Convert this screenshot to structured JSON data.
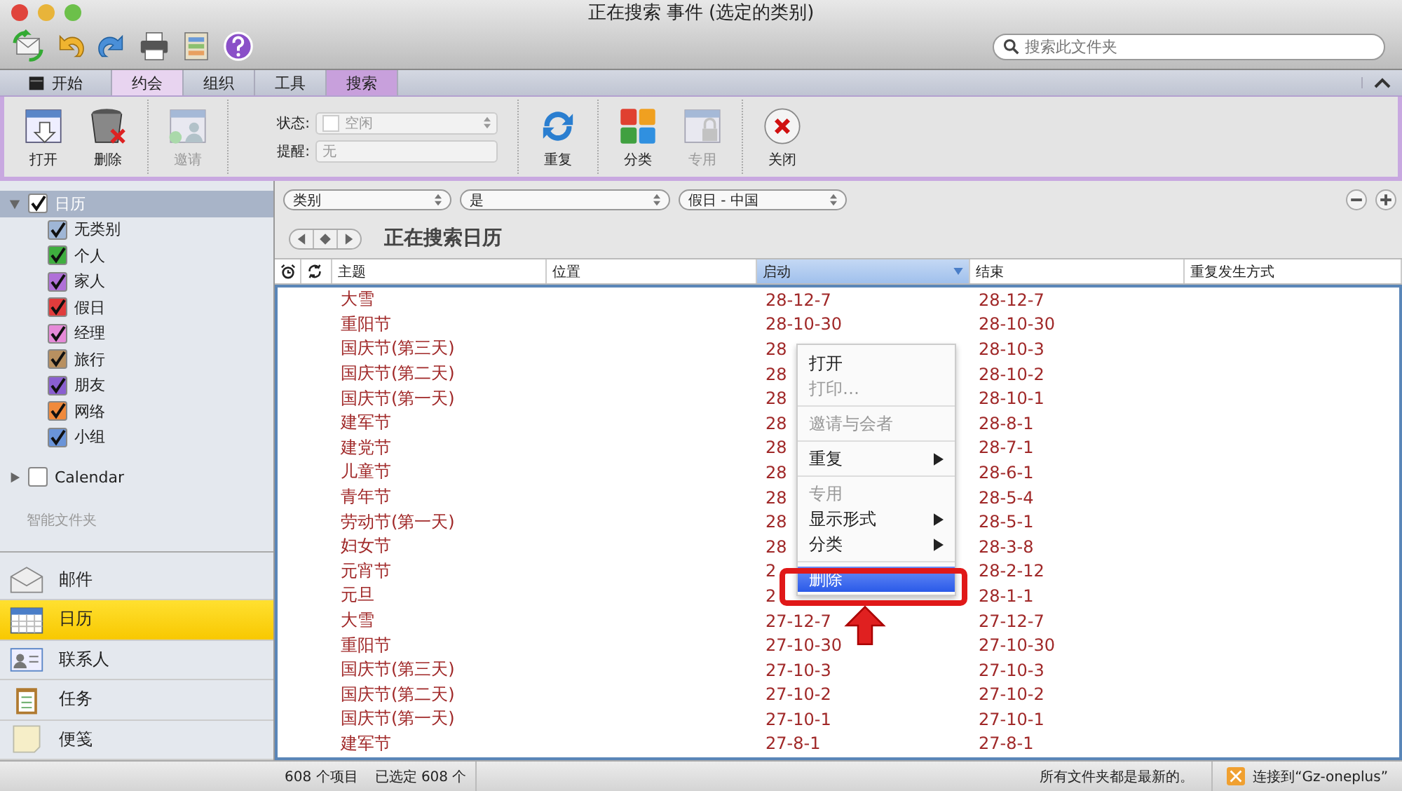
{
  "window": {
    "title": "正在搜索 事件 (选定的类别)"
  },
  "search": {
    "placeholder": "搜索此文件夹"
  },
  "tabs": [
    {
      "label": "开始",
      "selected": false,
      "contextual": false
    },
    {
      "label": "约会",
      "selected": false,
      "contextual": true
    },
    {
      "label": "组织",
      "selected": false,
      "contextual": false
    },
    {
      "label": "工具",
      "selected": false,
      "contextual": false
    },
    {
      "label": "搜索",
      "selected": true,
      "contextual": true
    }
  ],
  "ribbon": {
    "open": {
      "label": "打开"
    },
    "delete": {
      "label": "删除"
    },
    "invite": {
      "label": "邀请",
      "disabled": true
    },
    "status": {
      "label": "状态:",
      "value": "空闲",
      "disabled": true
    },
    "reminder": {
      "label": "提醒:",
      "value": "无",
      "disabled": true
    },
    "recurrence": {
      "label": "重复"
    },
    "categorize": {
      "label": "分类"
    },
    "private": {
      "label": "专用",
      "disabled": true
    },
    "close": {
      "label": "关闭"
    }
  },
  "sidebar": {
    "calendars": [
      {
        "label": "日历",
        "checked": true,
        "expanded": true,
        "selected": true,
        "children": [
          {
            "label": "无类别",
            "checked": true,
            "color": "#9fb6d6"
          },
          {
            "label": "个人",
            "checked": true,
            "color": "#3fae3f"
          },
          {
            "label": "家人",
            "checked": true,
            "color": "#b070d8"
          },
          {
            "label": "假日",
            "checked": true,
            "color": "#e03c3c"
          },
          {
            "label": "经理",
            "checked": true,
            "color": "#e68ad8"
          },
          {
            "label": "旅行",
            "checked": true,
            "color": "#b89060"
          },
          {
            "label": "朋友",
            "checked": true,
            "color": "#8a5fd0"
          },
          {
            "label": "网络",
            "checked": true,
            "color": "#f08a3c"
          },
          {
            "label": "小组",
            "checked": true,
            "color": "#6a94d8"
          }
        ]
      },
      {
        "label": "Calendar",
        "checked": false,
        "expanded": false,
        "selected": false
      }
    ],
    "smart_folders": "智能文件夹",
    "nav": [
      {
        "label": "邮件",
        "selected": false,
        "kind": "mail"
      },
      {
        "label": "日历",
        "selected": true,
        "kind": "calendar"
      },
      {
        "label": "联系人",
        "selected": false,
        "kind": "contacts"
      },
      {
        "label": "任务",
        "selected": false,
        "kind": "tasks"
      },
      {
        "label": "便笺",
        "selected": false,
        "kind": "notes"
      }
    ]
  },
  "filters": [
    "类别",
    "是",
    "假日 - 中国"
  ],
  "heading": "正在搜索日历",
  "table": {
    "columns": [
      {
        "kind": "alarm",
        "selected": false
      },
      {
        "kind": "recurrence",
        "selected": false
      },
      {
        "label": "主题",
        "selected": false
      },
      {
        "label": "位置",
        "selected": false
      },
      {
        "label": "启动",
        "selected": true
      },
      {
        "label": "结束",
        "selected": false
      },
      {
        "label": "重复发生方式",
        "selected": false
      }
    ],
    "rows": [
      {
        "subject": "大雪",
        "start": "28-12-7",
        "end": "28-12-7"
      },
      {
        "subject": "重阳节",
        "start": "28-10-30",
        "end": "28-10-30"
      },
      {
        "subject": "国庆节(第三天)",
        "start": "28",
        "end": "28-10-3"
      },
      {
        "subject": "国庆节(第二天)",
        "start": "28",
        "end": "28-10-2"
      },
      {
        "subject": "国庆节(第一天)",
        "start": "28",
        "end": "28-10-1"
      },
      {
        "subject": "建军节",
        "start": "28",
        "end": "28-8-1"
      },
      {
        "subject": "建党节",
        "start": "28",
        "end": "28-7-1"
      },
      {
        "subject": "儿童节",
        "start": "28",
        "end": "28-6-1"
      },
      {
        "subject": "青年节",
        "start": "28",
        "end": "28-5-4"
      },
      {
        "subject": "劳动节(第一天)",
        "start": "28",
        "end": "28-5-1"
      },
      {
        "subject": "妇女节",
        "start": "28",
        "end": "28-3-8"
      },
      {
        "subject": "元宵节",
        "start": "2",
        "end": "28-2-12"
      },
      {
        "subject": "元旦",
        "start": "2",
        "end": "28-1-1"
      },
      {
        "subject": "大雪",
        "start": "27-12-7",
        "end": "27-12-7"
      },
      {
        "subject": "重阳节",
        "start": "27-10-30",
        "end": "27-10-30"
      },
      {
        "subject": "国庆节(第三天)",
        "start": "27-10-3",
        "end": "27-10-3"
      },
      {
        "subject": "国庆节(第二天)",
        "start": "27-10-2",
        "end": "27-10-2"
      },
      {
        "subject": "国庆节(第一天)",
        "start": "27-10-1",
        "end": "27-10-1"
      },
      {
        "subject": "建军节",
        "start": "27-8-1",
        "end": "27-8-1"
      }
    ]
  },
  "context_menu": [
    {
      "kind": "item",
      "label": "打开",
      "disabled": false,
      "submenu": false,
      "selected": false
    },
    {
      "kind": "item",
      "label": "打印…",
      "disabled": true,
      "submenu": false,
      "selected": false
    },
    {
      "kind": "separator"
    },
    {
      "kind": "item",
      "label": "邀请与会者",
      "disabled": true,
      "submenu": false,
      "selected": false
    },
    {
      "kind": "separator"
    },
    {
      "kind": "item",
      "label": "重复",
      "disabled": false,
      "submenu": true,
      "selected": false
    },
    {
      "kind": "separator"
    },
    {
      "kind": "item",
      "label": "专用",
      "disabled": true,
      "submenu": false,
      "selected": false
    },
    {
      "kind": "item",
      "label": "显示形式",
      "disabled": false,
      "submenu": true,
      "selected": false
    },
    {
      "kind": "item",
      "label": "分类",
      "disabled": false,
      "submenu": true,
      "selected": false
    },
    {
      "kind": "separator"
    },
    {
      "kind": "item",
      "label": "删除",
      "disabled": false,
      "submenu": false,
      "selected": true
    }
  ],
  "status_bar": {
    "items": "608 个项目",
    "selected": "已选定 608 个",
    "sync": "所有文件夹都是最新的。",
    "connection": "连接到“Gz-oneplus”"
  }
}
